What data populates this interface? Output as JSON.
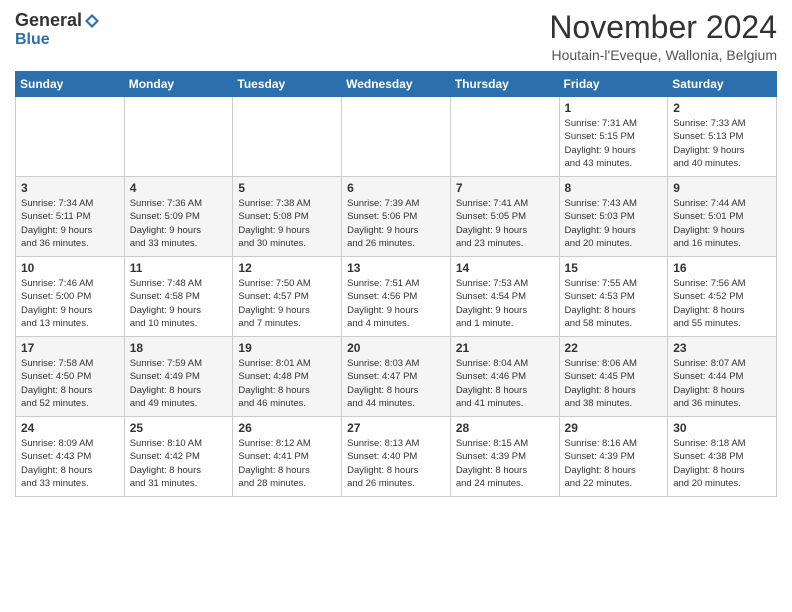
{
  "header": {
    "logo_general": "General",
    "logo_blue": "Blue",
    "month_title": "November 2024",
    "location": "Houtain-l'Eveque, Wallonia, Belgium"
  },
  "days_of_week": [
    "Sunday",
    "Monday",
    "Tuesday",
    "Wednesday",
    "Thursday",
    "Friday",
    "Saturday"
  ],
  "weeks": [
    [
      {
        "day": "",
        "info": ""
      },
      {
        "day": "",
        "info": ""
      },
      {
        "day": "",
        "info": ""
      },
      {
        "day": "",
        "info": ""
      },
      {
        "day": "",
        "info": ""
      },
      {
        "day": "1",
        "info": "Sunrise: 7:31 AM\nSunset: 5:15 PM\nDaylight: 9 hours\nand 43 minutes."
      },
      {
        "day": "2",
        "info": "Sunrise: 7:33 AM\nSunset: 5:13 PM\nDaylight: 9 hours\nand 40 minutes."
      }
    ],
    [
      {
        "day": "3",
        "info": "Sunrise: 7:34 AM\nSunset: 5:11 PM\nDaylight: 9 hours\nand 36 minutes."
      },
      {
        "day": "4",
        "info": "Sunrise: 7:36 AM\nSunset: 5:09 PM\nDaylight: 9 hours\nand 33 minutes."
      },
      {
        "day": "5",
        "info": "Sunrise: 7:38 AM\nSunset: 5:08 PM\nDaylight: 9 hours\nand 30 minutes."
      },
      {
        "day": "6",
        "info": "Sunrise: 7:39 AM\nSunset: 5:06 PM\nDaylight: 9 hours\nand 26 minutes."
      },
      {
        "day": "7",
        "info": "Sunrise: 7:41 AM\nSunset: 5:05 PM\nDaylight: 9 hours\nand 23 minutes."
      },
      {
        "day": "8",
        "info": "Sunrise: 7:43 AM\nSunset: 5:03 PM\nDaylight: 9 hours\nand 20 minutes."
      },
      {
        "day": "9",
        "info": "Sunrise: 7:44 AM\nSunset: 5:01 PM\nDaylight: 9 hours\nand 16 minutes."
      }
    ],
    [
      {
        "day": "10",
        "info": "Sunrise: 7:46 AM\nSunset: 5:00 PM\nDaylight: 9 hours\nand 13 minutes."
      },
      {
        "day": "11",
        "info": "Sunrise: 7:48 AM\nSunset: 4:58 PM\nDaylight: 9 hours\nand 10 minutes."
      },
      {
        "day": "12",
        "info": "Sunrise: 7:50 AM\nSunset: 4:57 PM\nDaylight: 9 hours\nand 7 minutes."
      },
      {
        "day": "13",
        "info": "Sunrise: 7:51 AM\nSunset: 4:56 PM\nDaylight: 9 hours\nand 4 minutes."
      },
      {
        "day": "14",
        "info": "Sunrise: 7:53 AM\nSunset: 4:54 PM\nDaylight: 9 hours\nand 1 minute."
      },
      {
        "day": "15",
        "info": "Sunrise: 7:55 AM\nSunset: 4:53 PM\nDaylight: 8 hours\nand 58 minutes."
      },
      {
        "day": "16",
        "info": "Sunrise: 7:56 AM\nSunset: 4:52 PM\nDaylight: 8 hours\nand 55 minutes."
      }
    ],
    [
      {
        "day": "17",
        "info": "Sunrise: 7:58 AM\nSunset: 4:50 PM\nDaylight: 8 hours\nand 52 minutes."
      },
      {
        "day": "18",
        "info": "Sunrise: 7:59 AM\nSunset: 4:49 PM\nDaylight: 8 hours\nand 49 minutes."
      },
      {
        "day": "19",
        "info": "Sunrise: 8:01 AM\nSunset: 4:48 PM\nDaylight: 8 hours\nand 46 minutes."
      },
      {
        "day": "20",
        "info": "Sunrise: 8:03 AM\nSunset: 4:47 PM\nDaylight: 8 hours\nand 44 minutes."
      },
      {
        "day": "21",
        "info": "Sunrise: 8:04 AM\nSunset: 4:46 PM\nDaylight: 8 hours\nand 41 minutes."
      },
      {
        "day": "22",
        "info": "Sunrise: 8:06 AM\nSunset: 4:45 PM\nDaylight: 8 hours\nand 38 minutes."
      },
      {
        "day": "23",
        "info": "Sunrise: 8:07 AM\nSunset: 4:44 PM\nDaylight: 8 hours\nand 36 minutes."
      }
    ],
    [
      {
        "day": "24",
        "info": "Sunrise: 8:09 AM\nSunset: 4:43 PM\nDaylight: 8 hours\nand 33 minutes."
      },
      {
        "day": "25",
        "info": "Sunrise: 8:10 AM\nSunset: 4:42 PM\nDaylight: 8 hours\nand 31 minutes."
      },
      {
        "day": "26",
        "info": "Sunrise: 8:12 AM\nSunset: 4:41 PM\nDaylight: 8 hours\nand 28 minutes."
      },
      {
        "day": "27",
        "info": "Sunrise: 8:13 AM\nSunset: 4:40 PM\nDaylight: 8 hours\nand 26 minutes."
      },
      {
        "day": "28",
        "info": "Sunrise: 8:15 AM\nSunset: 4:39 PM\nDaylight: 8 hours\nand 24 minutes."
      },
      {
        "day": "29",
        "info": "Sunrise: 8:16 AM\nSunset: 4:39 PM\nDaylight: 8 hours\nand 22 minutes."
      },
      {
        "day": "30",
        "info": "Sunrise: 8:18 AM\nSunset: 4:38 PM\nDaylight: 8 hours\nand 20 minutes."
      }
    ]
  ]
}
